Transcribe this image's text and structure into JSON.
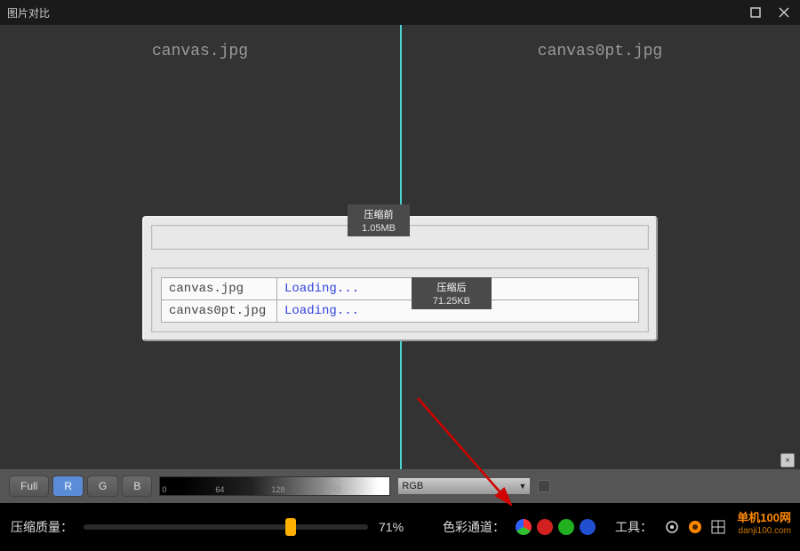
{
  "titlebar": {
    "title": "图片对比"
  },
  "compare": {
    "left_filename": "canvas.jpg",
    "right_filename": "canvas0pt.jpg"
  },
  "info_panel": {
    "before_label": "压缩前",
    "before_size": "1.05MB",
    "after_label": "压缩后",
    "after_size": "71.25KB",
    "rows": [
      {
        "filename": "canvas.jpg",
        "status": "Loading..."
      },
      {
        "filename": "canvas0pt.jpg",
        "status": "Loading..."
      }
    ]
  },
  "mid_toolbar": {
    "buttons": {
      "full": "Full",
      "r": "R",
      "g": "G",
      "b": "B"
    },
    "histogram_ticks": [
      "0",
      "64",
      "128",
      "192"
    ],
    "dropdown_value": "RGB"
  },
  "bottom_toolbar": {
    "quality_label": "压缩质量：",
    "quality_percent": 71,
    "quality_display": "71%",
    "color_channel_label": "色彩通道：",
    "tools_label": "工具："
  },
  "watermark": {
    "main": "单机100网",
    "sub": "danji100.com"
  }
}
